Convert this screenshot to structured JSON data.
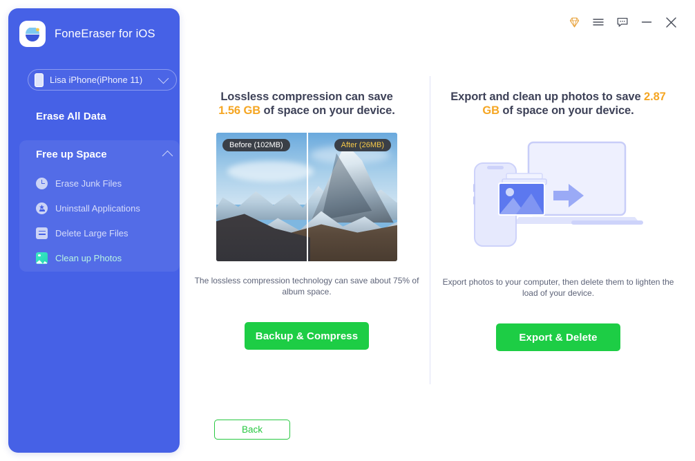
{
  "app": {
    "title": "FoneEraser for iOS",
    "logo_icon": "app-logo-icon"
  },
  "titlebar": {
    "buttons": [
      {
        "name": "diamond-icon",
        "label": "Upgrade",
        "color": "#e8a33d"
      },
      {
        "name": "menu-icon",
        "label": "Menu",
        "color": "#4a4f5c"
      },
      {
        "name": "feedback-icon",
        "label": "Feedback",
        "color": "#4a4f5c"
      },
      {
        "name": "minimize-icon",
        "label": "Minimize",
        "color": "#4a4f5c"
      },
      {
        "name": "close-icon",
        "label": "Close",
        "color": "#4a4f5c"
      }
    ]
  },
  "sidebar": {
    "device": {
      "name": "Lisa iPhone(iPhone 11)",
      "icon": "phone-icon",
      "chevron": "chevron-down-icon"
    },
    "top_link": "Erase All Data",
    "group": {
      "label": "Free up Space",
      "chevron": "chevron-up-icon",
      "expanded": true,
      "items": [
        {
          "label": "Erase Junk Files",
          "icon": "clock-icon",
          "active": false
        },
        {
          "label": "Uninstall Applications",
          "icon": "uninstall-icon",
          "active": false
        },
        {
          "label": "Delete Large Files",
          "icon": "document-icon",
          "active": false
        },
        {
          "label": "Clean up Photos",
          "icon": "photo-icon",
          "active": true
        }
      ]
    }
  },
  "main": {
    "left": {
      "heading_line1": "Lossless compression can save",
      "heading_highlight": "1.56 GB",
      "heading_line2_rest": " of space on your device.",
      "before_badge": "Before (102MB)",
      "after_badge": "After (26MB)",
      "caption": "The lossless compression technology can save about 75% of album space.",
      "cta_label": "Backup & Compress"
    },
    "right": {
      "heading_pre": "Export and clean up photos to save ",
      "heading_highlight": "2.87 GB",
      "heading_post": " of space on your device.",
      "caption": "Export photos to your computer, then delete them to lighten the load of your device.",
      "cta_label": "Export & Delete"
    },
    "back_label": "Back"
  },
  "colors": {
    "sidebar_bg": "#4661e6",
    "accent_green": "#1dcd45",
    "highlight_orange": "#f5a623",
    "active_teal": "#b9f5e3"
  }
}
